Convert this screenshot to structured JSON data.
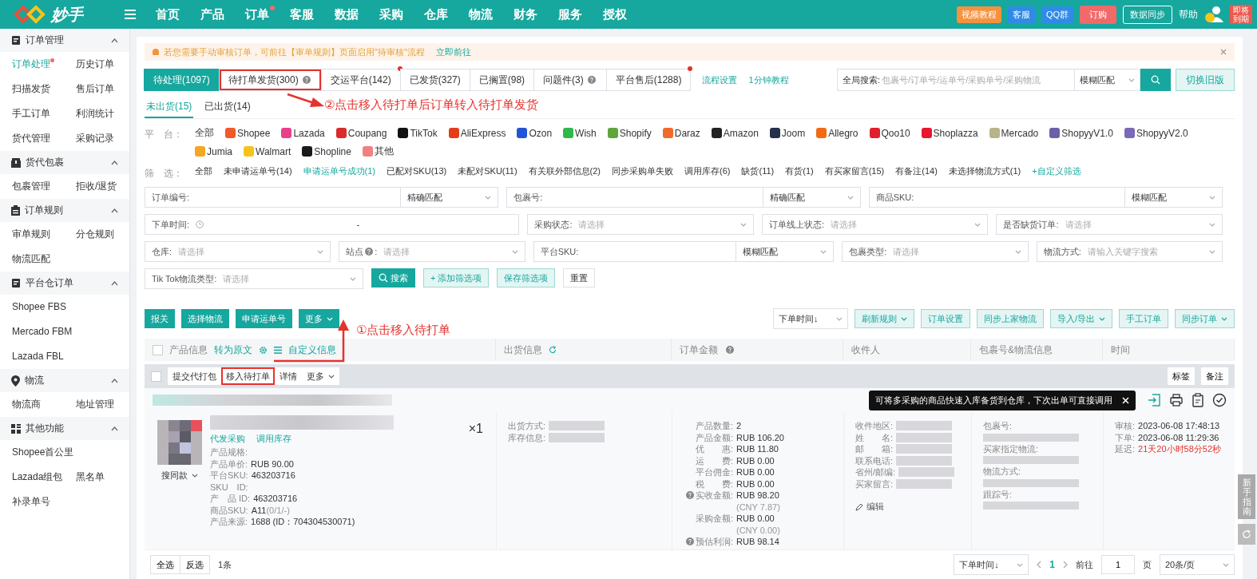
{
  "topbar": {
    "logo": "妙手",
    "nav": [
      {
        "label": "首页",
        "dot": false
      },
      {
        "label": "产品",
        "dot": false
      },
      {
        "label": "订单",
        "dot": true
      },
      {
        "label": "客服",
        "dot": false
      },
      {
        "label": "数据",
        "dot": false
      },
      {
        "label": "采购",
        "dot": false
      },
      {
        "label": "仓库",
        "dot": false
      },
      {
        "label": "物流",
        "dot": false
      },
      {
        "label": "财务",
        "dot": false
      },
      {
        "label": "服务",
        "dot": false
      },
      {
        "label": "授权",
        "dot": false
      }
    ],
    "actions": [
      {
        "label": "视频教程",
        "kind": "video"
      },
      {
        "label": "客服",
        "kind": "avatar"
      },
      {
        "label": "QQ群",
        "kind": "avatar"
      },
      {
        "label": "订购",
        "kind": "cart"
      },
      {
        "label": "数据同步",
        "kind": "cloud"
      },
      {
        "label": "帮助",
        "kind": "help"
      }
    ],
    "badge": "即将到期"
  },
  "sidebar": [
    {
      "title": "订单管理",
      "expanded": true,
      "items": [
        {
          "label": "订单处理",
          "selected": true,
          "dot": true
        },
        {
          "label": "历史订单",
          "selected": false,
          "dot": false
        },
        {
          "label": "扫描发货",
          "selected": false,
          "dot": false
        },
        {
          "label": "售后订单",
          "selected": false,
          "dot": false
        },
        {
          "label": "手工订单",
          "selected": false,
          "dot": false
        },
        {
          "label": "利润统计",
          "selected": false,
          "dot": false
        },
        {
          "label": "货代管理",
          "selected": false,
          "dot": false
        },
        {
          "label": "采购记录",
          "selected": false,
          "dot": false
        }
      ]
    },
    {
      "title": "货代包裹",
      "expanded": true,
      "items": [
        {
          "label": "包裹管理",
          "selected": false,
          "dot": false
        },
        {
          "label": "拒收/退货",
          "selected": false,
          "dot": false
        }
      ]
    },
    {
      "title": "订单规则",
      "expanded": true,
      "items": [
        {
          "label": "审单规则",
          "selected": false,
          "dot": false
        },
        {
          "label": "分仓规则",
          "selected": false,
          "dot": false
        },
        {
          "label": "物流匹配",
          "selected": false,
          "dot": false
        }
      ]
    },
    {
      "title": "平台仓订单",
      "expanded": true,
      "items": [
        {
          "label": "Shopee FBS",
          "selected": false,
          "dot": false
        },
        {
          "label": "Mercado FBM",
          "selected": false,
          "dot": false
        },
        {
          "label": "Lazada FBL",
          "selected": false,
          "dot": false
        }
      ]
    },
    {
      "title": "物流",
      "expanded": true,
      "items": [
        {
          "label": "物流商",
          "selected": false,
          "dot": false
        },
        {
          "label": "地址管理",
          "selected": false,
          "dot": false
        }
      ]
    },
    {
      "title": "其他功能",
      "expanded": true,
      "items": [
        {
          "label": "Shopee首公里",
          "selected": false,
          "dot": false
        },
        {
          "label": "Lazada组包",
          "selected": false,
          "dot": false
        },
        {
          "label": "黑名单",
          "selected": false,
          "dot": false
        },
        {
          "label": "补录单号",
          "selected": false,
          "dot": false
        }
      ]
    }
  ],
  "notice": {
    "text": "若您需要手动审核订单，可前往【审单规则】页面启用\"待审核\"流程",
    "link": "立即前往"
  },
  "status_tabs": [
    {
      "label": "待处理(1097)",
      "selected": true,
      "help": false,
      "dot": false,
      "annotated": false
    },
    {
      "label": "待打单发货(300)",
      "selected": false,
      "help": true,
      "dot": false,
      "annotated": true
    },
    {
      "label": "交运平台(142)",
      "selected": false,
      "help": false,
      "dot": true,
      "annotated": false
    },
    {
      "label": "已发货(327)",
      "selected": false,
      "help": false,
      "dot": false,
      "annotated": false
    },
    {
      "label": "已搁置(98)",
      "selected": false,
      "help": false,
      "dot": false,
      "annotated": false
    },
    {
      "label": "问题件(3)",
      "selected": false,
      "help": true,
      "dot": false,
      "annotated": false
    },
    {
      "label": "平台售后(1288)",
      "selected": false,
      "help": false,
      "dot": true,
      "annotated": false
    }
  ],
  "tab_links": [
    "流程设置",
    "1分钟教程"
  ],
  "global_search": {
    "label": "全局搜索:",
    "placeholder": "包裹号/订单号/运单号/采购单号/采购物流",
    "match": "模糊匹配"
  },
  "switch_button": "切换旧版",
  "sub_tabs": [
    {
      "label": "未出货(15)",
      "selected": true
    },
    {
      "label": "已出货(14)",
      "selected": false
    }
  ],
  "platform_label": "平　台：",
  "platforms": [
    {
      "label": "全部",
      "selected": false
    },
    {
      "label": "Shopee",
      "color": "#f05a28",
      "selected": false
    },
    {
      "label": "Lazada",
      "color": "#e8408a",
      "selected": false
    },
    {
      "label": "Coupang",
      "color": "#d92b2b",
      "selected": false
    },
    {
      "label": "TikTok",
      "color": "#111111",
      "selected": false
    },
    {
      "label": "AliExpress",
      "color": "#e43d1a",
      "selected": false
    },
    {
      "label": "Ozon",
      "color": "#1f55d6",
      "selected": false
    },
    {
      "label": "Wish",
      "color": "#2fb84a",
      "selected": false
    },
    {
      "label": "Shopify",
      "color": "#5ea63b",
      "selected": false
    },
    {
      "label": "Daraz",
      "color": "#f06a2a",
      "selected": false
    },
    {
      "label": "Amazon",
      "color": "#222222",
      "selected": false
    },
    {
      "label": "Joom",
      "color": "#25304a",
      "selected": false
    },
    {
      "label": "Allegro",
      "color": "#f26b12",
      "selected": false
    },
    {
      "label": "Qoo10",
      "color": "#e0202d",
      "selected": false
    },
    {
      "label": "Shoplazza",
      "color": "#e8162e",
      "selected": false
    },
    {
      "label": "Mercado",
      "color": "#b8b48a",
      "selected": false
    },
    {
      "label": "ShopyyV1.0",
      "color": "#6c5fa8",
      "selected": false
    },
    {
      "label": "ShopyyV2.0",
      "color": "#7a68b8",
      "selected": false
    },
    {
      "label": "Jumia",
      "color": "#f5a623",
      "selected": false
    },
    {
      "label": "Walmart",
      "color": "#f7c31a",
      "selected": false
    },
    {
      "label": "Shopline",
      "color": "#1a1a1a",
      "selected": false
    },
    {
      "label": "其他",
      "color": "#f08080",
      "selected": false
    }
  ],
  "filter_label": "筛　选：",
  "filters": [
    {
      "label": "全部",
      "selected": false
    },
    {
      "label": "未申请运单号(14)",
      "selected": false
    },
    {
      "label": "申请运单号成功(1)",
      "selected": true
    },
    {
      "label": "已配对SKU(13)",
      "selected": false
    },
    {
      "label": "未配对SKU(11)",
      "selected": false
    },
    {
      "label": "有关联外部信息(2)",
      "selected": false
    },
    {
      "label": "同步采购单失败",
      "selected": false
    },
    {
      "label": "调用库存(6)",
      "selected": false
    },
    {
      "label": "缺货(11)",
      "selected": false
    },
    {
      "label": "有货(1)",
      "selected": false
    },
    {
      "label": "有买家留言(15)",
      "selected": false
    },
    {
      "label": "有备注(14)",
      "selected": false
    },
    {
      "label": "未选择物流方式(1)",
      "selected": false
    }
  ],
  "custom_filter": "+自定义筛选",
  "form_rows": [
    [
      {
        "label": "订单编号:",
        "kind": "input",
        "match": "精确匹配"
      },
      {
        "label": "包裹号:",
        "kind": "input",
        "match": "精确匹配"
      },
      {
        "label": "商品SKU:",
        "kind": "input",
        "match": "模糊匹配"
      }
    ],
    [
      {
        "label": "下单时间:",
        "kind": "date",
        "separator": "-"
      },
      {
        "label": "采购状态:",
        "kind": "select",
        "placeholder": "请选择"
      },
      {
        "label": "订单线上状态:",
        "kind": "select",
        "placeholder": "请选择"
      },
      {
        "label": "是否缺货订单:",
        "kind": "select",
        "placeholder": "请选择"
      }
    ],
    [
      {
        "label": "仓库:",
        "kind": "select",
        "placeholder": "请选择"
      },
      {
        "label": "站点",
        "help": true,
        "suffix": ":",
        "kind": "select",
        "placeholder": "请选择"
      },
      {
        "label": "平台SKU:",
        "kind": "input",
        "match": "模糊匹配"
      },
      {
        "label": "包裹类型:",
        "kind": "select",
        "placeholder": "请选择"
      },
      {
        "label": "物流方式:",
        "kind": "select",
        "placeholder": "请输入关键字搜索"
      }
    ],
    [
      {
        "label": "Tik Tok物流类型:",
        "kind": "select",
        "placeholder": "请选择"
      }
    ]
  ],
  "form_buttons": [
    {
      "label": "搜索",
      "kind": "primary"
    },
    {
      "label": "+ 添加筛选项",
      "kind": "light"
    },
    {
      "label": "保存筛选项",
      "kind": "light"
    },
    {
      "label": "重置",
      "kind": "plain"
    }
  ],
  "bulk_actions": [
    {
      "label": "报关",
      "caret": false
    },
    {
      "label": "选择物流",
      "caret": false
    },
    {
      "label": "申请运单号",
      "caret": false
    },
    {
      "label": "更多",
      "caret": true
    }
  ],
  "sort": "下单时间↓",
  "right_actions": [
    {
      "label": "刷新规则",
      "caret": true
    },
    {
      "label": "订单设置",
      "caret": false
    },
    {
      "label": "同步上家物流",
      "caret": false
    },
    {
      "label": "导入/导出",
      "caret": true
    },
    {
      "label": "手工订单",
      "caret": false
    },
    {
      "label": "同步订单",
      "caret": true
    }
  ],
  "table_header": {
    "checked": false,
    "product": "产品信息",
    "translate": "转为原文",
    "custom": "自定义信息",
    "shipping": "出货信息",
    "amount": "订单金额",
    "recipient": "收件人",
    "package": "包裹号&物流信息",
    "time": "时间"
  },
  "row_checked": false,
  "row_actions": [
    {
      "label": "提交代打包",
      "caret": false,
      "annotated": false
    },
    {
      "label": "移入待打单",
      "caret": false,
      "annotated": true
    },
    {
      "label": "详情",
      "caret": false,
      "annotated": false
    },
    {
      "label": "更多",
      "caret": true,
      "annotated": false
    }
  ],
  "row_tools": [
    "标签",
    "备注"
  ],
  "tooltip": "可将多采购的商品快速入库备货到仓库，下次出单可直接调用",
  "order": {
    "quantity": "×1",
    "similar": "搜同款",
    "links": [
      "代发采购",
      "调用库存"
    ],
    "product_fields": [
      {
        "label": "产品规格:"
      },
      {
        "label": "产品单价:",
        "value": "RUB 90.00"
      },
      {
        "label": "平台SKU:",
        "value": "463203716"
      },
      {
        "label": "SKU　ID:"
      },
      {
        "label": "产　品 ID:",
        "value": "463203716"
      },
      {
        "label": "商品SKU:",
        "value": "A11",
        "note": "(0/1/-)"
      },
      {
        "label": "产品来源:",
        "value": "1688 (ID：704304530071)"
      }
    ],
    "shipping_fields": [
      "出货方式:",
      "库存信息:"
    ],
    "amounts": [
      {
        "label": "产品数量:",
        "value": "2",
        "help": false
      },
      {
        "label": "产品金额:",
        "value": "RUB 106.20",
        "help": false
      },
      {
        "label": "优　　惠:",
        "value": "RUB 11.80",
        "help": false
      },
      {
        "label": "运　　费:",
        "value": "RUB 0.00",
        "help": false
      },
      {
        "label": "平台佣金:",
        "value": "RUB 0.00",
        "help": false
      },
      {
        "label": "税　　费:",
        "value": "RUB 0.00",
        "help": false
      },
      {
        "label": "实收金额:",
        "value": "RUB 98.20",
        "sub": "(CNY 7.87)",
        "help": true
      },
      {
        "label": "采购金额:",
        "value": "RUB 0.00",
        "sub": "(CNY 0.00)",
        "help": false
      },
      {
        "label": "预估利润:",
        "value": "RUB 98.14",
        "help": true
      }
    ],
    "recipient_fields": [
      "收件地区:",
      "姓　　名:",
      "邮　　箱:",
      "联系电话:",
      "省州/邮编:",
      "买家留言:"
    ],
    "edit": "编辑",
    "package_fields": [
      "包裹号:",
      "买家指定物流:",
      "物流方式:",
      "跟踪号:"
    ],
    "times": [
      {
        "label": "审核:",
        "value": "2023-06-08 17:48:13",
        "kind": "normal"
      },
      {
        "label": "下单:",
        "value": "2023-06-08 11:29:36",
        "kind": "normal"
      },
      {
        "label": "延迟:",
        "value": "21天20小时58分52秒",
        "kind": "warning"
      }
    ]
  },
  "footer": {
    "select_all": "全选",
    "invert": "反选",
    "count": "1条",
    "sort": "下单时间↓",
    "page": "1",
    "goto": "前往",
    "goto_value": "1",
    "page_unit": "页",
    "page_size": "20条/页"
  },
  "side_guide": "新手指南",
  "annotations": [
    "②点击移入待打单后订单转入待打单发货",
    "①点击移入待打单"
  ]
}
